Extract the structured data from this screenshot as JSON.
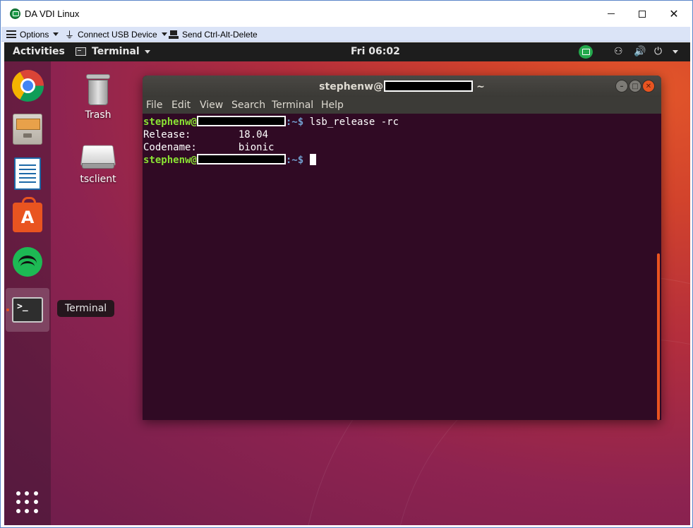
{
  "window": {
    "title": "DA VDI Linux",
    "minimize_glyph": "",
    "close_glyph": "✕"
  },
  "toolbar": {
    "options_label": "Options",
    "usb_label": "Connect USB Device",
    "cad_label": "Send Ctrl-Alt-Delete"
  },
  "top_panel": {
    "activities": "Activities",
    "app_name": "Terminal",
    "clock": "Fri 06:02",
    "network_glyph": "⚇",
    "volume_glyph": "🔊",
    "power_glyph": "⏻"
  },
  "dock": {
    "terminal_glyph": ">_",
    "software_glyph": "A",
    "tooltip": "Terminal"
  },
  "desktop": {
    "icons": [
      {
        "label": "Trash"
      },
      {
        "label": "tsclient"
      }
    ]
  },
  "terminal": {
    "title_user": "stephenw@",
    "title_path": "~",
    "menu": [
      "File",
      "Edit",
      "View",
      "Search",
      "Terminal",
      "Help"
    ],
    "prompt_user": "stephenw@",
    "prompt_suffix": ":~$ ",
    "command": "lsb_release -rc",
    "output": [
      "Release:\t18.04",
      "Codename:\tbionic"
    ],
    "output_lines": [
      "Release:        18.04",
      "Codename:       bionic"
    ]
  },
  "colors": {
    "accent": "#e95420",
    "terminal_bg": "#300a24",
    "prompt_user": "#8ae234",
    "prompt_path": "#729fcf"
  }
}
